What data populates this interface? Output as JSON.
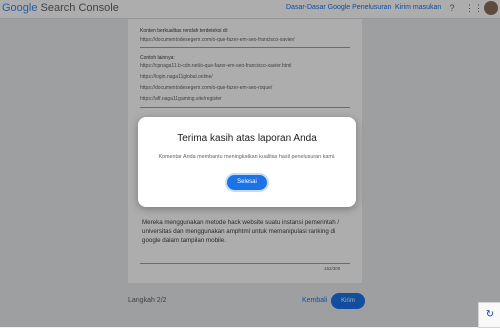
{
  "header": {
    "logo_google": "Google",
    "logo_product": "Search Console",
    "link_basics": "Dasar-Dasar Google Penelusuran",
    "link_feedback": "Kirim masukan",
    "icons": [
      "help-icon",
      "apps-icon",
      "avatar"
    ]
  },
  "card": {
    "label_low_quality": "Konten berkualitas rendah terdeteksi di:",
    "low_quality_url": "https://documentodesegem.com/o-que-fazer-em-seo-francisco-xavier/",
    "label_examples": "Contoh lainnya:",
    "example_urls": [
      "https://cpnaga11.b-cdn.net/o-que-fazer-em-seo-francisco-xavier.html",
      "https://login.naga11global.online/",
      "https://documentodesegem.com/o-que-fazer-em-seo-roque/",
      "https://aff.naga11gaming.site/register"
    ],
    "description": "Mereka menggunakan metode hack website suatu instansi pemerintah / universitas dan menggunakan amphtml untuk memanipulasi ranking di google dalam tampilan mobile.",
    "counter": "162/300"
  },
  "footer": {
    "step": "Langkah 2/2",
    "back": "Kembali",
    "send": "Kirim"
  },
  "dialog": {
    "title": "Terima kasih atas laporan Anda",
    "body": "Komentar Anda membantu meningkatkan kualitas hasil penelusuran kami.",
    "button": "Selesai"
  },
  "colors": {
    "accent": "#1a73e8"
  }
}
